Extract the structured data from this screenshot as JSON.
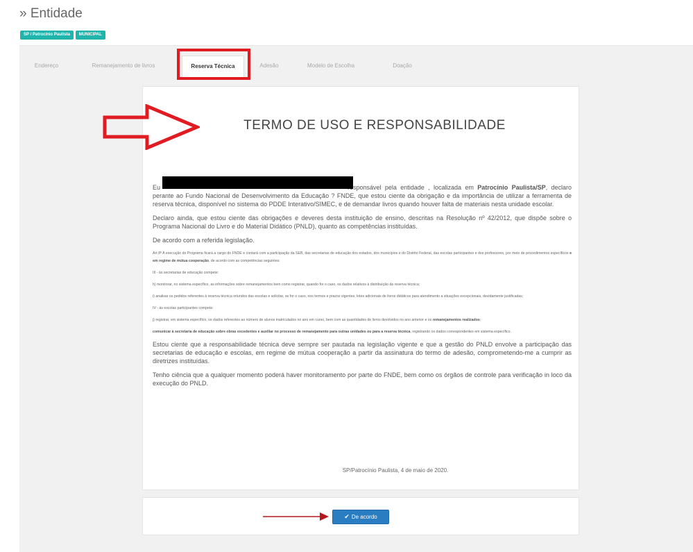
{
  "header": {
    "title": "» Entidade",
    "badges": [
      "SP / Patrocínio Paulista",
      "MUNICIPAL"
    ]
  },
  "tabs": [
    {
      "label": "Endereço",
      "active": false
    },
    {
      "label": "Remanejamento de livros",
      "active": false
    },
    {
      "label": "Reserva Técnica",
      "active": true
    },
    {
      "label": "Adesão",
      "active": false
    },
    {
      "label": "Modelo de Escolha",
      "active": false
    },
    {
      "label": "Doação",
      "active": false
    }
  ],
  "term": {
    "title": "TERMO DE USO E RESPONSABILIDADE",
    "p1_a": "Eu",
    "p1_b": "responsável pela entidade , localizada em",
    "p1_city": "Patrocínio Paulista/SP",
    "p1_c": ", declaro perante ao Fundo Nacional de Desenvolvimento da Educação ? FNDE, que estou ciente da obrigação e da importância de utilizar a ferramenta de reserva técnica, disponível no sistema do PDDE Interativo/SIMEC, e de demandar livros quando houver falta de materiais nesta unidade escolar.",
    "p2": "Declaro ainda, que estou ciente das obrigações e deveres desta instituição de ensino, descritas na Resolução nº 42/2012, que dispõe sobre o Programa Nacional do Livro e do Material Didático (PNLD), quanto as competências instituídas.",
    "p3": "De acordo com a referida legislação.",
    "art_a": "Art 8º A execução do Programa ficará a cargo do FNDE e contará com a participação da SEB, das secretarias de educação dos estados, dos municípios e do Distrito Federal, das escolas participantes e dos professores, por meio de procedimentos específicos",
    "art_b": "e em regime de mútua cooperação",
    "art_c": ", de acordo com as competências seguintes:",
    "item_iii": "III - às secretarias de educação compete:",
    "item_h": "h) monitorar, no sistema específico, as informações sobre remanejamentos bem como registrar, quando for o caso, os dados relativos à distribuição da reserva técnica;",
    "item_i": "i) analisar os pedidos referentes à reserva técnica oriundos das escolas e solicitar, se for o caso, nos termos e prazos vigentes, lotes adicionais de livros didáticos para atendimento a situações excepcionais, devidamente justificadas;",
    "item_iv": "IV - às escolas participantes compete:",
    "item_j_a": "j) registrar, em sistema específico, os dados referentes ao número de alunos matriculados no ano em curso, bem com as quantidades de livros devolvidos no ano anterior e os",
    "item_j_b": "remanejamentos realizados",
    "item_j_c": ";",
    "item_l_a": "comunicar à secretaria de educação sobre obras excedentes e auxiliar no processo de remanejamento para outras unidades ou para a reserva técnica",
    "item_l_b": ", registrando os dados correspondentes em sistema específico.",
    "p_resp": "Estou ciente que a responsabilidade técnica deve sempre ser pautada na legislação vigente e que a gestão do PNLD envolve a participação das secretarias de educação e escolas, em regime de mútua cooperação a partir da assinatura do termo de adesão, comprometendo-me a cumprir as diretrizes instituídas.",
    "p_monit": "Tenho ciência que a qualquer momento poderá haver monitoramento por parte do FNDE, bem como os órgãos de controle para verificação in loco da execução do PNLD.",
    "signature": "SP/Patrocínio Paulista, 4 de maio de 2020."
  },
  "actions": {
    "agree_label": "De acordo"
  },
  "colors": {
    "badge": "#1fb5ad",
    "annotation": "#e01b22",
    "button": "#2b7dc1"
  }
}
